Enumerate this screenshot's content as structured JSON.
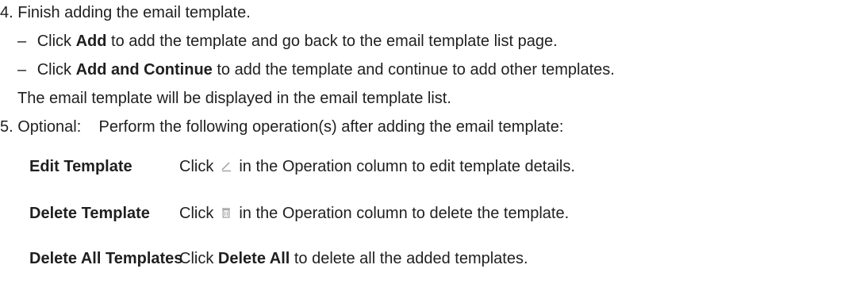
{
  "step4": {
    "number": "4.",
    "text": "Finish adding the email template.",
    "bullet1": {
      "dash": "–",
      "pre": "Click",
      "bold": "Add",
      "post": "to add the template and go back to the email template list page."
    },
    "bullet2": {
      "dash": "–",
      "pre": "Click",
      "bold": "Add and Continue",
      "post": "to add the template and continue to add other templates."
    },
    "result": "The email template will be displayed in the email template list."
  },
  "step5": {
    "number": "5.",
    "text": "Optional:    Perform the following operation(s) after adding the email template:"
  },
  "operations": [
    {
      "name": "Edit Template",
      "pre": "Click",
      "icon": "edit-pencil-icon",
      "post": "in the Operation column to edit template details."
    },
    {
      "name": "Delete Template",
      "pre": "Click",
      "icon": "trash-icon",
      "post": "in the Operation column to delete the template."
    },
    {
      "name": "Delete All Templates",
      "pre": "Click",
      "bold": "Delete All",
      "post": "to delete all the added templates."
    }
  ]
}
